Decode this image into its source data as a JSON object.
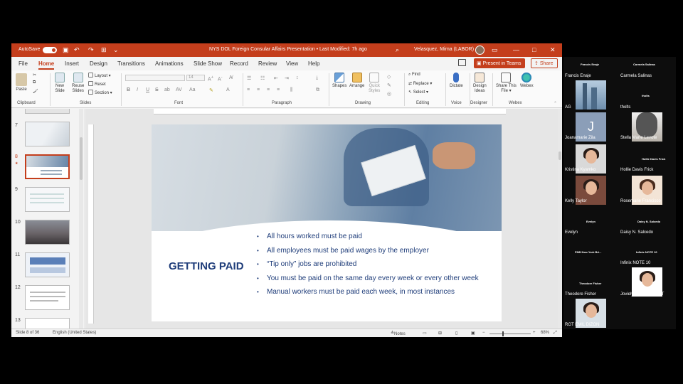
{
  "window": {
    "autosave_label": "AutoSave",
    "autosave_state": "On",
    "title": "NYS DOL Foreign Consular Affairs  Presentation • Last Modified: 7h ago",
    "user": "Velasquez, Mirna (LABOR)",
    "min": "—",
    "max": "□",
    "close": "✕"
  },
  "tabs": [
    "File",
    "Home",
    "Insert",
    "Design",
    "Transitions",
    "Animations",
    "Slide Show",
    "Record",
    "Review",
    "View",
    "Help"
  ],
  "present_in_teams": "Present in Teams",
  "share": "Share",
  "ribbon": {
    "clipboard": {
      "paste": "Paste",
      "label": "Clipboard"
    },
    "slides": {
      "new_slide": "New Slide",
      "new_slide_1": "New",
      "new_slide_2": "Slide",
      "reuse_1": "Reuse",
      "reuse_2": "Slides",
      "layout": "Layout",
      "reset": "Reset",
      "section": "Section",
      "label": "Slides"
    },
    "font": {
      "size": "14",
      "label": "Font",
      "bold": "B",
      "italic": "I",
      "underline": "U",
      "strike": "S",
      "shadow": "ab",
      "spacing": "AV",
      "case": "Aa"
    },
    "paragraph": {
      "label": "Paragraph"
    },
    "drawing": {
      "shapes": "Shapes",
      "arrange": "Arrange",
      "quick_styles_1": "Quick",
      "quick_styles_2": "Styles",
      "label": "Drawing"
    },
    "editing": {
      "find": "Find",
      "replace": "Replace",
      "select": "Select",
      "label": "Editing"
    },
    "voice": {
      "dictate": "Dictate",
      "label": "Voice"
    },
    "designer": {
      "design_ideas_1": "Design",
      "design_ideas_2": "Ideas",
      "label": "Designer"
    },
    "webex": {
      "share_this_file_1": "Share This",
      "share_this_file_2": "File",
      "webex": "Webex",
      "label": "Webex"
    }
  },
  "thumbnails": [
    {
      "num": "7",
      "selected": false
    },
    {
      "num": "8",
      "selected": true
    },
    {
      "num": "9",
      "selected": false
    },
    {
      "num": "10",
      "selected": false
    },
    {
      "num": "11",
      "selected": false
    },
    {
      "num": "12",
      "selected": false
    },
    {
      "num": "13",
      "selected": false
    }
  ],
  "slide": {
    "title": "GETTING PAID",
    "bullets": [
      "All hours worked must be paid",
      "All employees must be paid wages by the employer",
      "“Tip only” jobs are prohibited",
      "You must be paid on the same day every week or every other week",
      "Manual workers must be paid each week, in most instances"
    ]
  },
  "status": {
    "slide_of": "Slide 8 of 36",
    "language": "English (United States)",
    "notes": "Notes",
    "zoom": "68%"
  },
  "participants": [
    {
      "header": "Francis Enaje",
      "name": "Francis Enaje"
    },
    {
      "header": "Carmela Salinas",
      "name": "Carmela Salinas"
    },
    {
      "header": "",
      "name": "AG"
    },
    {
      "header": "tholts",
      "name": "tholts"
    },
    {
      "header": "",
      "name": "Joanamarie Zila"
    },
    {
      "header": "",
      "name": "Stella Marie Levote"
    },
    {
      "header": "",
      "name": "Kristina Kyamko"
    },
    {
      "header": "Hollie Davis Frick",
      "name": "Hollie Davis Frick"
    },
    {
      "header": "",
      "name": "Kelly Taylor"
    },
    {
      "header": "",
      "name": "Rosemarie Francisco"
    },
    {
      "header": "Evelyn",
      "name": "Evelyn"
    },
    {
      "header": "Daisy N. Salcedo",
      "name": "Daisy N. Salcedo"
    },
    {
      "header": "PNB New York Bri...",
      "name": ""
    },
    {
      "header": "Infinix NOTE 10",
      "name": "Infinix NOTE 10"
    },
    {
      "header": "Theodore Fisher",
      "name": "Theodore Fisher"
    },
    {
      "header": "",
      "name": "Jovielyn Ethel NAQUIT"
    },
    {
      "header": "",
      "name": "RGT EMIL DIZON"
    }
  ],
  "avatar_letter": "J",
  "colors": {
    "accent": "#c43e1c",
    "slide_text": "#1f3d7a"
  }
}
